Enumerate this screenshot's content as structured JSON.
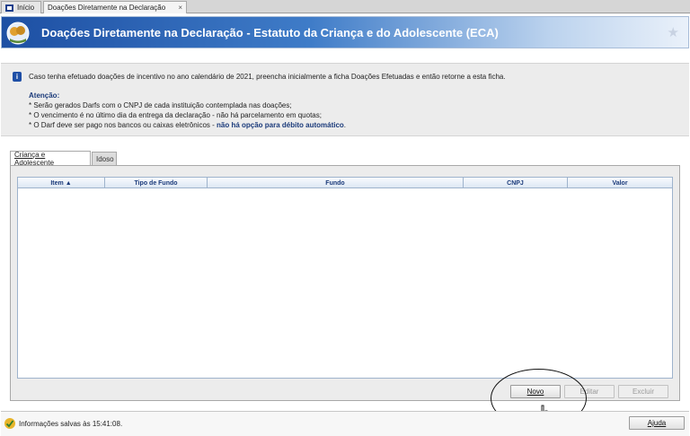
{
  "tabs": {
    "home_label": "Início",
    "active_label": "Doações Diretamente na Declaração",
    "close_glyph": "×"
  },
  "banner": {
    "title": "Doações Diretamente na Declaração - Estatuto da Criança e do Adolescente (ECA)"
  },
  "info": {
    "icon_glyph": "i",
    "message": "Caso tenha efetuado doações de incentivo no ano calendário de 2021, preencha inicialmente a ficha Doações Efetuadas e então retorne a esta ficha.",
    "attention_title": "Atenção:",
    "line1": "* Serão gerados Darfs com o CNPJ de cada instituição contemplada nas doações;",
    "line2": "* O vencimento é no último dia da entrega da declaração - não há parcelamento em quotas;",
    "line3_prefix": "* O Darf deve ser pago nos bancos ou caixas eletrônicos - ",
    "line3_bold": "não há opção para débito automático",
    "line3_suffix": "."
  },
  "inner_tabs": [
    "Criança e Adolescente",
    "Idoso"
  ],
  "grid": {
    "columns": [
      "Item ▲",
      "Tipo de Fundo",
      "Fundo",
      "CNPJ",
      "Valor"
    ]
  },
  "buttons": {
    "novo": "Novo",
    "editar": "Editar",
    "excluir": "Excluir",
    "ajuda": "Ajuda"
  },
  "status": {
    "text": "Informações salvas às 15:41:08."
  },
  "colors": {
    "banner_dark": "#1d4fa3",
    "accent_text": "#1a3a7a",
    "info_icon": "#1f4fa6"
  }
}
